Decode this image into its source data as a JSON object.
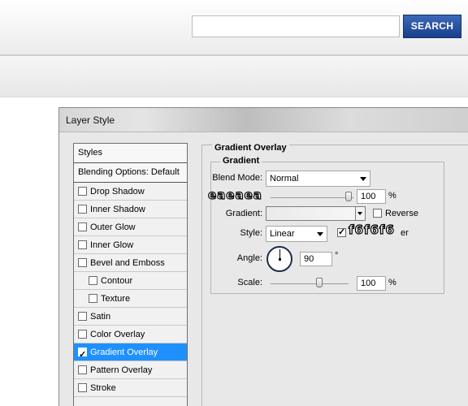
{
  "header": {
    "search_placeholder": "",
    "search_button": "SEARCH"
  },
  "dialog": {
    "title": "Layer Style",
    "styles_list": [
      {
        "label": "Styles",
        "checkbox": false,
        "checked": false,
        "indent": false,
        "kind": "header"
      },
      {
        "label": "Blending Options: Default",
        "checkbox": false,
        "checked": false,
        "indent": false,
        "kind": "header"
      },
      {
        "label": "Drop Shadow",
        "checkbox": true,
        "checked": false,
        "indent": false
      },
      {
        "label": "Inner Shadow",
        "checkbox": true,
        "checked": false,
        "indent": false
      },
      {
        "label": "Outer Glow",
        "checkbox": true,
        "checked": false,
        "indent": false
      },
      {
        "label": "Inner Glow",
        "checkbox": true,
        "checked": false,
        "indent": false
      },
      {
        "label": "Bevel and Emboss",
        "checkbox": true,
        "checked": false,
        "indent": false
      },
      {
        "label": "Contour",
        "checkbox": true,
        "checked": false,
        "indent": true
      },
      {
        "label": "Texture",
        "checkbox": true,
        "checked": false,
        "indent": true
      },
      {
        "label": "Satin",
        "checkbox": true,
        "checked": false,
        "indent": false
      },
      {
        "label": "Color Overlay",
        "checkbox": true,
        "checked": false,
        "indent": false
      },
      {
        "label": "Gradient Overlay",
        "checkbox": true,
        "checked": true,
        "indent": false,
        "selected": true
      },
      {
        "label": "Pattern Overlay",
        "checkbox": true,
        "checked": false,
        "indent": false
      },
      {
        "label": "Stroke",
        "checkbox": true,
        "checked": false,
        "indent": false
      }
    ],
    "panel": {
      "section_title": "Gradient Overlay",
      "group_title": "Gradient",
      "blend_mode_label": "Blend Mode:",
      "blend_mode_value": "Normal",
      "opacity_value": "100",
      "opacity_unit": "%",
      "gradient_label": "Gradient:",
      "reverse_label": "Reverse",
      "style_label": "Style:",
      "style_value": "Linear",
      "align_label": "er",
      "angle_label": "Angle:",
      "angle_value": "90",
      "angle_unit": "°",
      "scale_label": "Scale:",
      "scale_value": "100",
      "scale_unit": "%",
      "annotation_left": "eaeaea",
      "annotation_right": "f6f6f6"
    },
    "colors": {
      "gradient_start": "#eaeaea",
      "gradient_end": "#f6f6f6",
      "selection": "#1e90ff"
    }
  }
}
